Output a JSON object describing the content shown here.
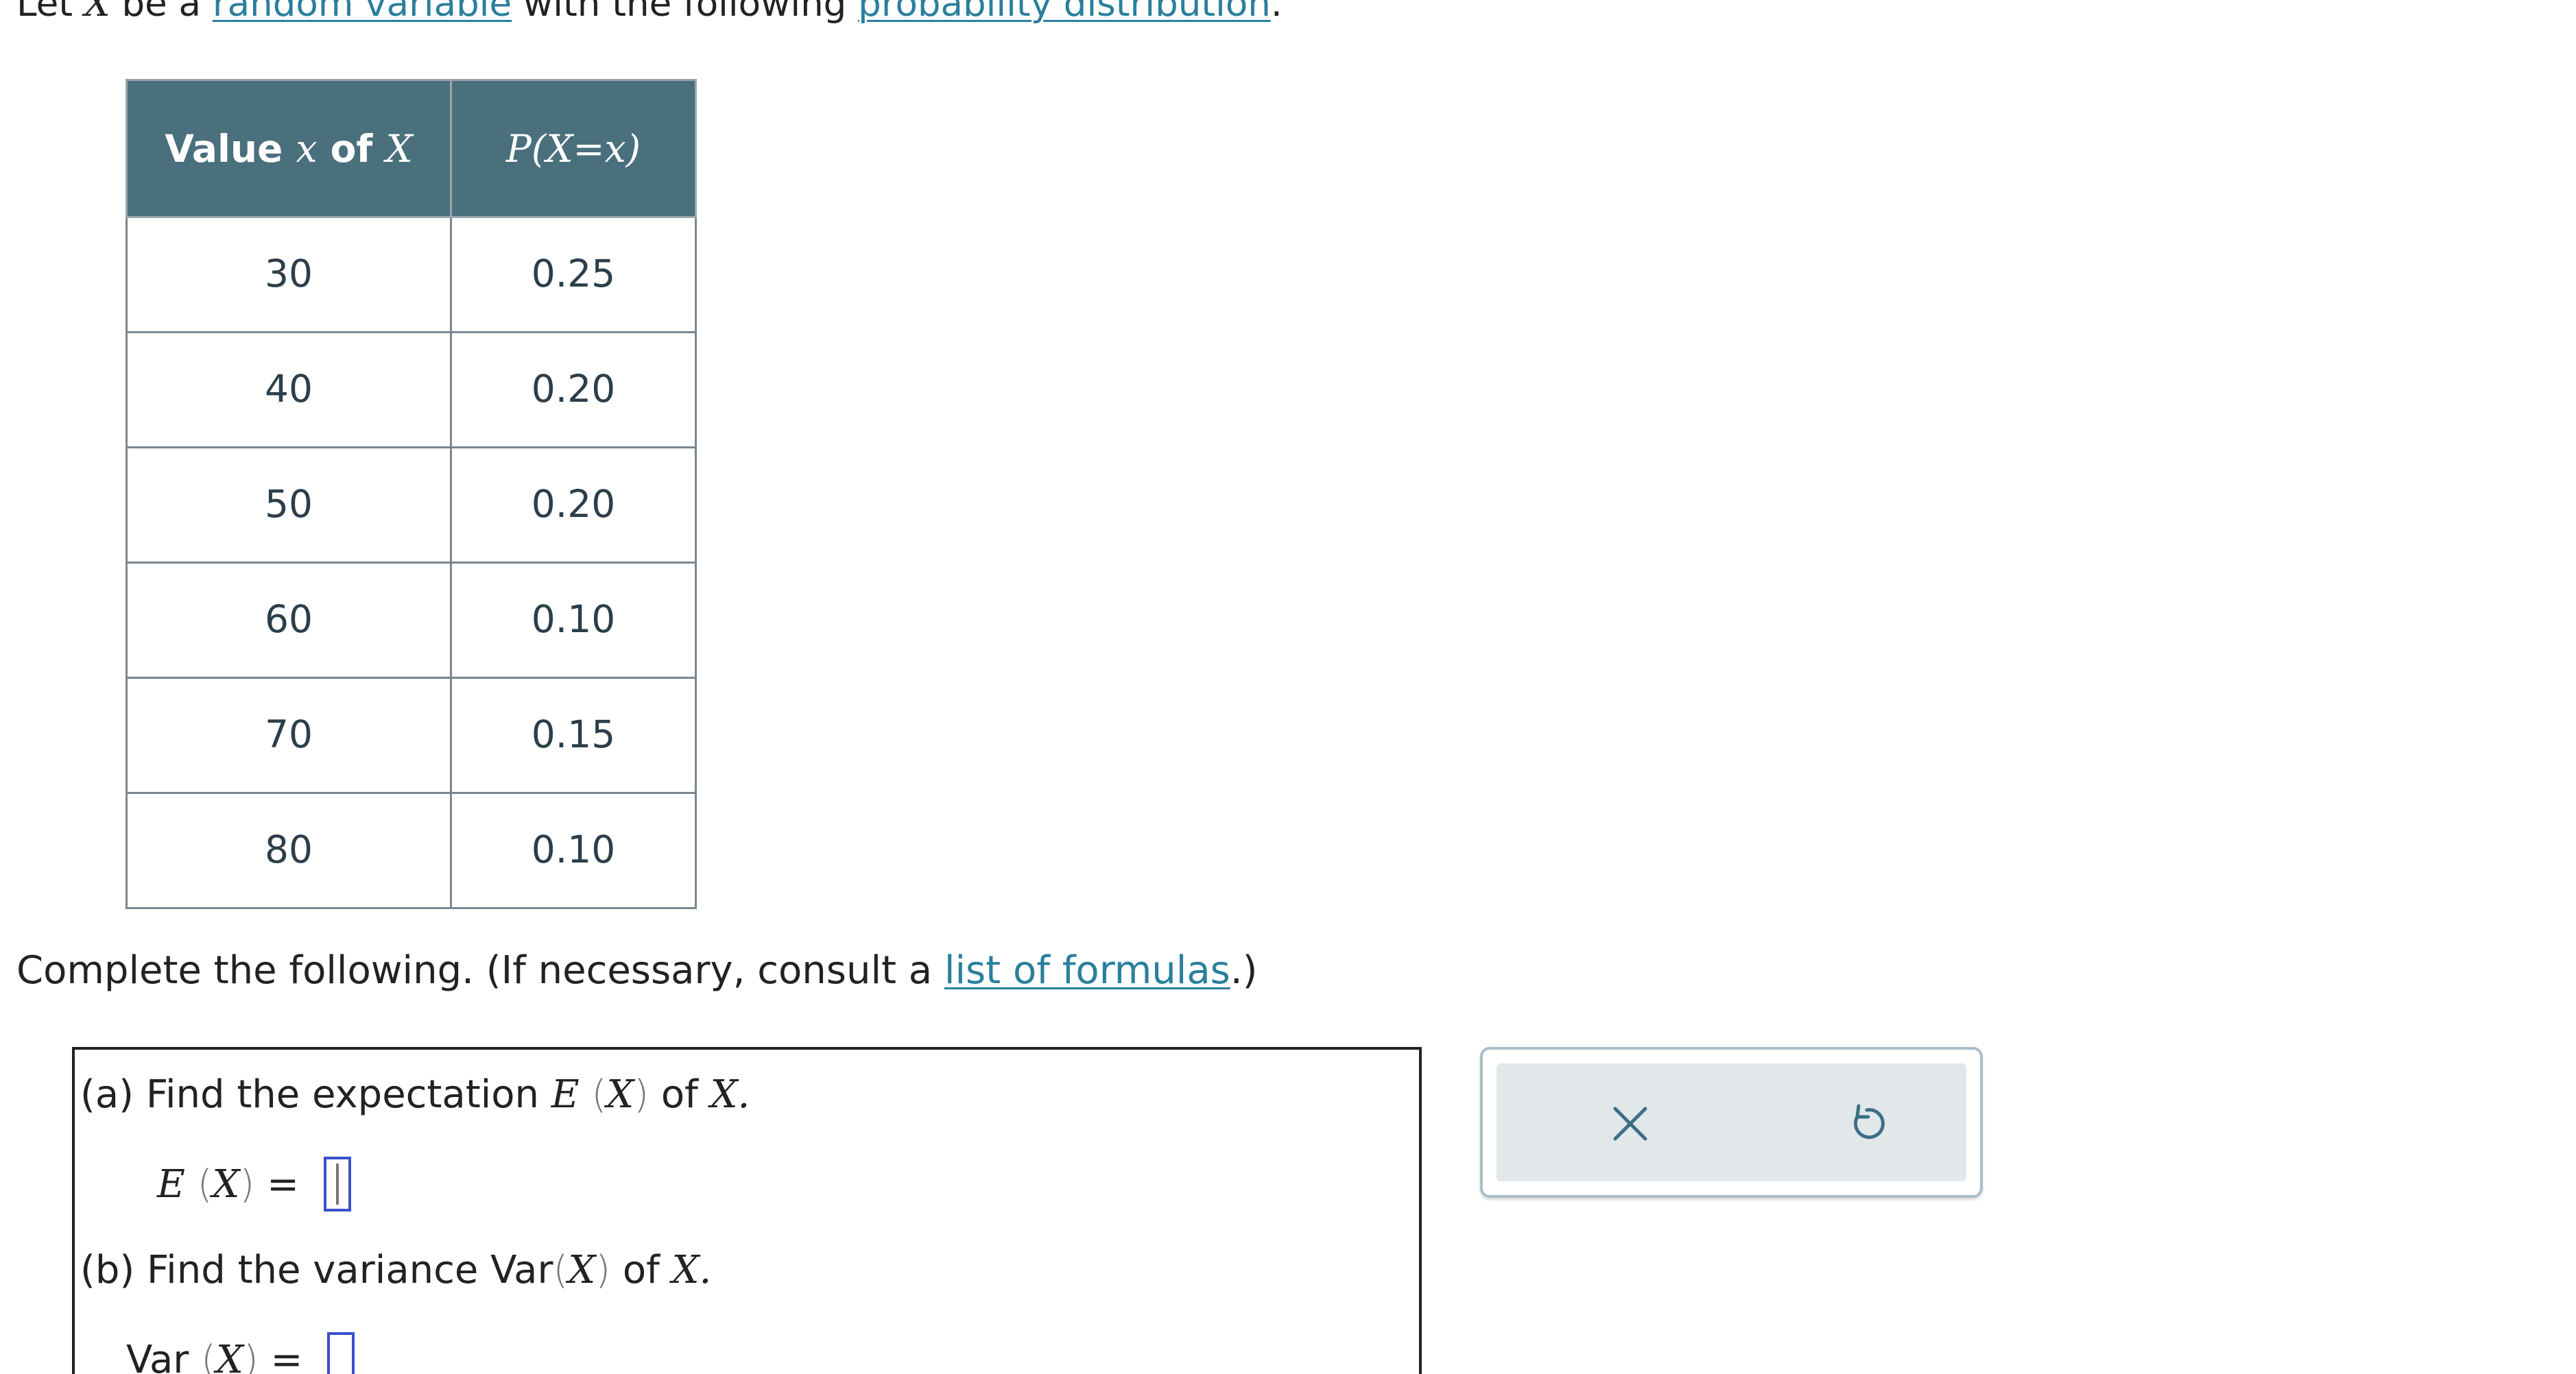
{
  "intro": {
    "text_1": "Let ",
    "var": "X",
    "text_2": " be a ",
    "link_random_variable": "random variable",
    "text_3": " with the following ",
    "link_probability_distribution": "probability distribution",
    "text_4": "."
  },
  "table": {
    "header_x_prefix": "Value ",
    "header_x_var": "x",
    "header_x_mid": " of ",
    "header_x_var2": "X",
    "header_p": "P(X=x)",
    "rows": [
      {
        "x": "30",
        "p": "0.25"
      },
      {
        "x": "40",
        "p": "0.20"
      },
      {
        "x": "50",
        "p": "0.20"
      },
      {
        "x": "60",
        "p": "0.10"
      },
      {
        "x": "70",
        "p": "0.15"
      },
      {
        "x": "80",
        "p": "0.10"
      }
    ]
  },
  "complete": {
    "text_1": "Complete the following. (If necessary, consult a ",
    "link_formulas": "list of formulas",
    "text_2": ".)"
  },
  "questions": {
    "a_prefix": "(a) Find the expectation ",
    "a_math": "E",
    "a_suffix": " of ",
    "a_var_end": "X.",
    "a_eq_label": "E",
    "b_prefix": "(b) Find the variance Var",
    "b_suffix": " of ",
    "b_var_end": "X.",
    "b_eq_label": "Var",
    "var": "X",
    "equals": "="
  },
  "tools": {
    "clear_icon": "close-icon",
    "undo_icon": "undo-icon",
    "icon_color": "#3b6f86"
  },
  "colors": {
    "header_bg": "#4a6f7d",
    "link": "#2a7f9c",
    "answer_box": "#3a4fcf"
  }
}
